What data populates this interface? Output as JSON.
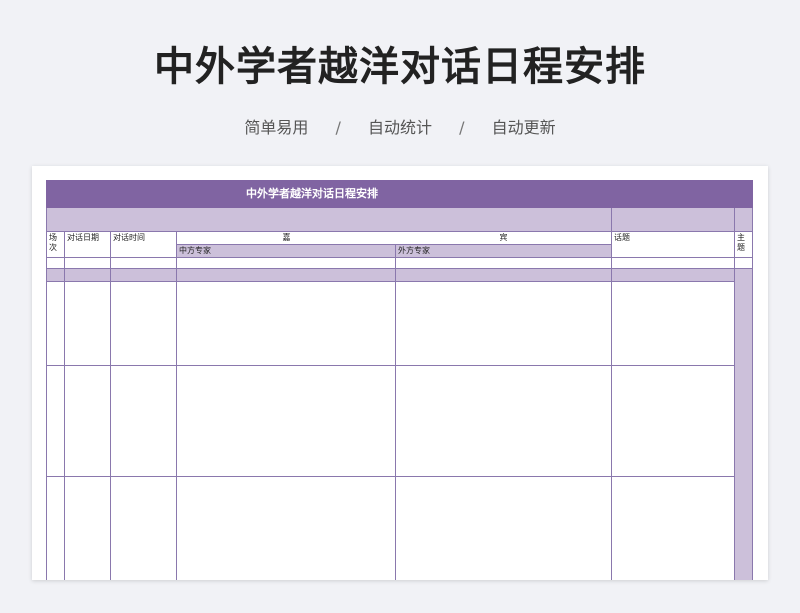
{
  "header": {
    "title": "中外学者越洋对话日程安排",
    "tags": [
      "简单易用",
      "自动统计",
      "自动更新"
    ],
    "separator": "/"
  },
  "sheet": {
    "title": "中外学者越洋对话日程安排",
    "columns": {
      "session": "场次",
      "date": "对话日期",
      "time": "对话时间",
      "guest_left": "嘉",
      "guest_right": "宾",
      "chinese_expert": "中方专家",
      "foreign_expert": "外方专家",
      "topic": "话题",
      "theme": "主题"
    }
  },
  "colors": {
    "accent": "#8064a2",
    "light": "#ccc0da",
    "grid": "#8a78ad",
    "background": "#f1f2f6"
  }
}
